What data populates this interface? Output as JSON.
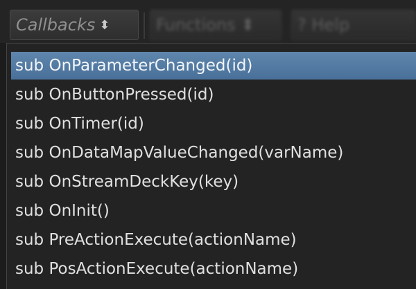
{
  "toolbar": {
    "callbacks_label": "Callbacks",
    "callbacks_arrows": "⬍",
    "functions_label": "Functions ⬍",
    "help_label": "? Help"
  },
  "dropdown": {
    "items": [
      "sub OnParameterChanged(id)",
      "sub OnButtonPressed(id)",
      "sub OnTimer(id)",
      "sub OnDataMapValueChanged(varName)",
      "sub OnStreamDeckKey(key)",
      "sub OnInit()",
      "sub PreActionExecute(actionName)",
      "sub PosActionExecute(actionName)"
    ],
    "selected_index": 0
  },
  "colors": {
    "highlight": "#5a82aa",
    "background": "#232323",
    "text": "#e0e0e0"
  }
}
